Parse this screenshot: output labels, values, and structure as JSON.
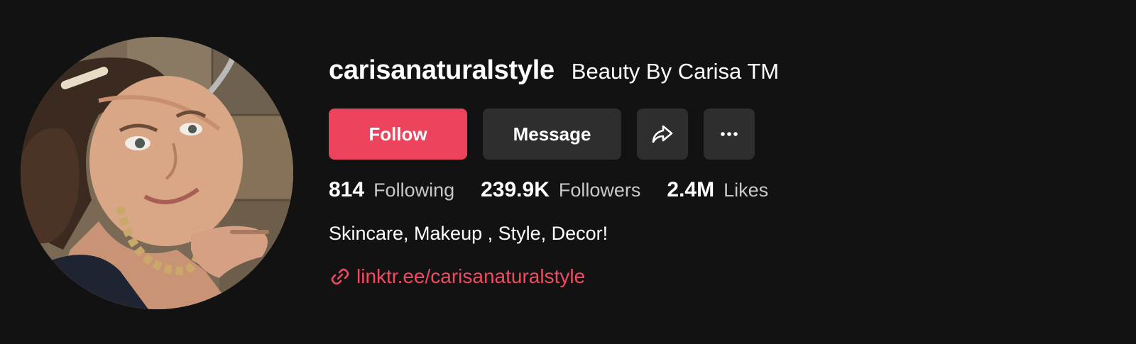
{
  "profile": {
    "username": "carisanaturalstyle",
    "nickname": "Beauty By Carisa TM",
    "avatar_icon": "profile-photo"
  },
  "actions": {
    "follow_label": "Follow",
    "message_label": "Message",
    "share_icon": "share-icon",
    "more_icon": "more-icon"
  },
  "stats": [
    {
      "value": "814",
      "label": "Following"
    },
    {
      "value": "239.9K",
      "label": "Followers"
    },
    {
      "value": "2.4M",
      "label": "Likes"
    }
  ],
  "bio": "Skincare, Makeup , Style, Decor!",
  "link": {
    "icon": "link-icon",
    "text": "linktr.ee/carisanaturalstyle"
  },
  "colors": {
    "background": "#121212",
    "accent": "#ea435b",
    "secondary_button": "#2e2e2e",
    "link": "#f04a63"
  }
}
